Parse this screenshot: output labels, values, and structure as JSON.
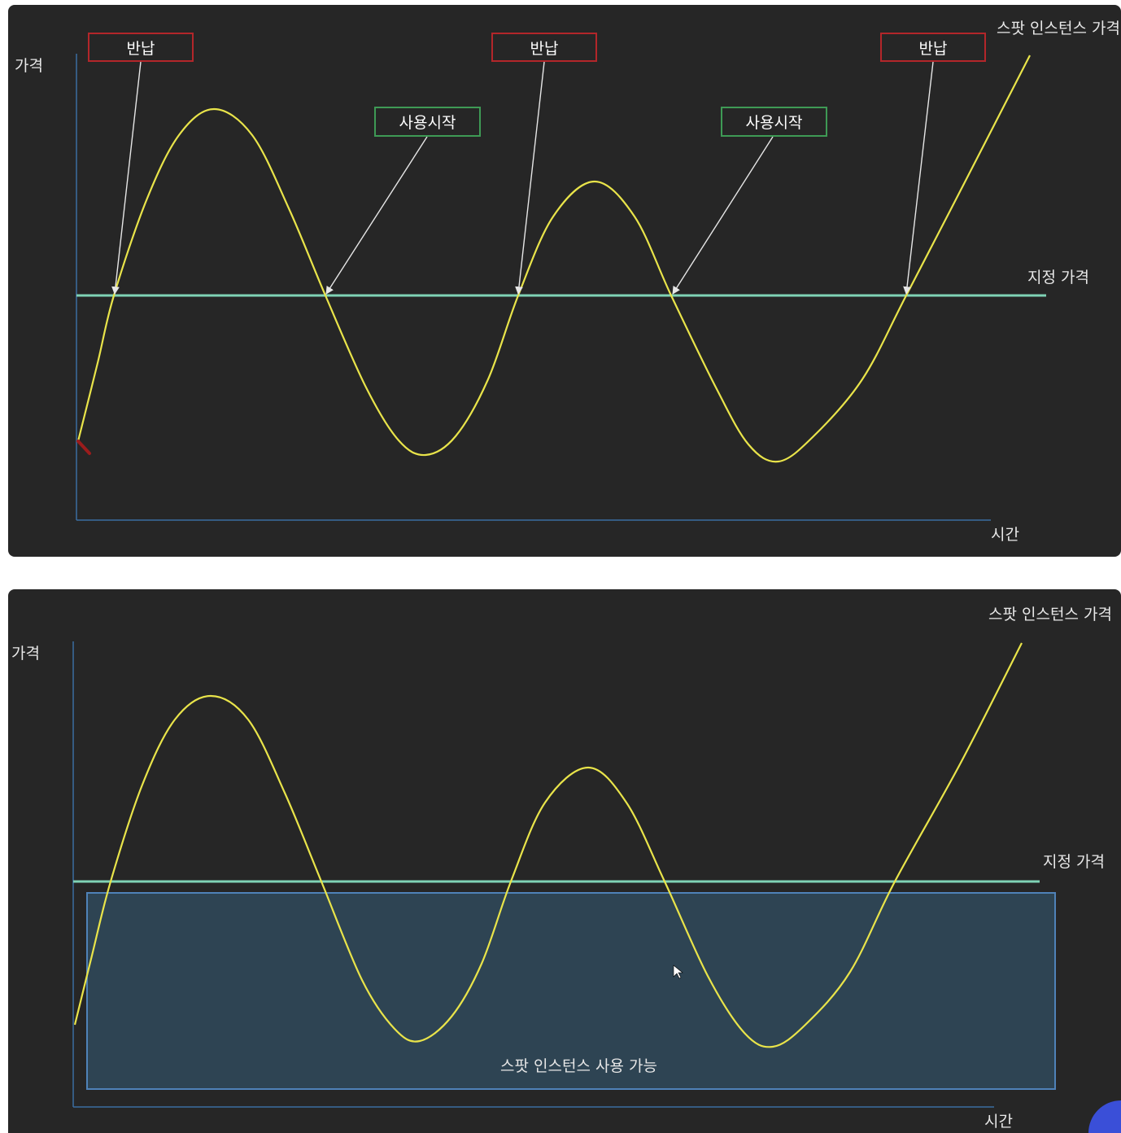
{
  "top_panel": {
    "y_axis_label": "가격",
    "x_axis_label": "시간",
    "series_label": "스팟 인스턴스 가격",
    "threshold_label": "지정 가격",
    "return_label": "반납",
    "start_label": "사용시작",
    "returns": [
      {
        "label": "반납"
      },
      {
        "label": "반납"
      },
      {
        "label": "반납"
      }
    ],
    "starts": [
      {
        "label": "사용시작"
      },
      {
        "label": "사용시작"
      }
    ]
  },
  "bottom_panel": {
    "y_axis_label": "가격",
    "x_axis_label": "시간",
    "series_label": "스팟 인스턴스 가격",
    "threshold_label": "지정 가격",
    "region_label": "스팟 인스턴스 사용 가능"
  },
  "colors": {
    "background": "#262626",
    "curve": "#e9e44a",
    "threshold": "#7fd3b5",
    "axis": "#3a6da0",
    "return_box": "#b3262a",
    "start_box": "#3e9a55",
    "region_fill": "#2e4453",
    "region_border": "#4f82b8",
    "arrow": "#e6e6e6"
  }
}
